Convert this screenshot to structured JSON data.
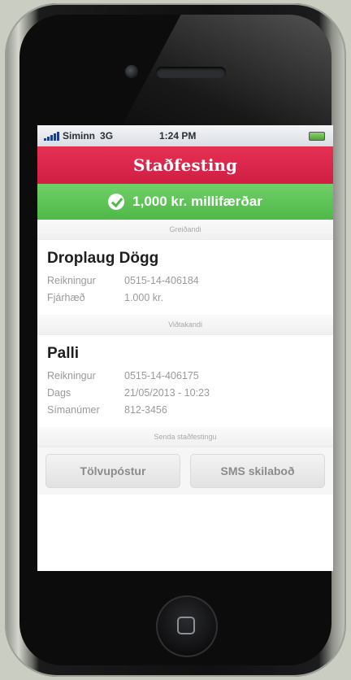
{
  "statusbar": {
    "carrier": "Siminn",
    "network": "3G",
    "time": "1:24 PM"
  },
  "title": "Staðfesting",
  "success_message": "1,000 kr. millifærðar",
  "sender": {
    "section_header": "Greiðandi",
    "name": "Droplaug Dögg",
    "rows": [
      {
        "label": "Reikningur",
        "value": "0515-14-406184"
      },
      {
        "label": "Fjárhæð",
        "value": "1.000 kr."
      }
    ]
  },
  "receiver": {
    "section_header": "Viðtakandi",
    "name": "Palli",
    "rows": [
      {
        "label": "Reikningur",
        "value": "0515-14-406175"
      },
      {
        "label": "Dags",
        "value": "21/05/2013 - 10:23"
      },
      {
        "label": "Símanúmer",
        "value": "812-3456"
      }
    ]
  },
  "send_confirmation_header": "Senda staðfestingu",
  "buttons": {
    "email": "Tölvupóstur",
    "sms": "SMS skilaboð"
  },
  "colors": {
    "title_bar": "#d82448",
    "success_bar": "#57bd50"
  }
}
